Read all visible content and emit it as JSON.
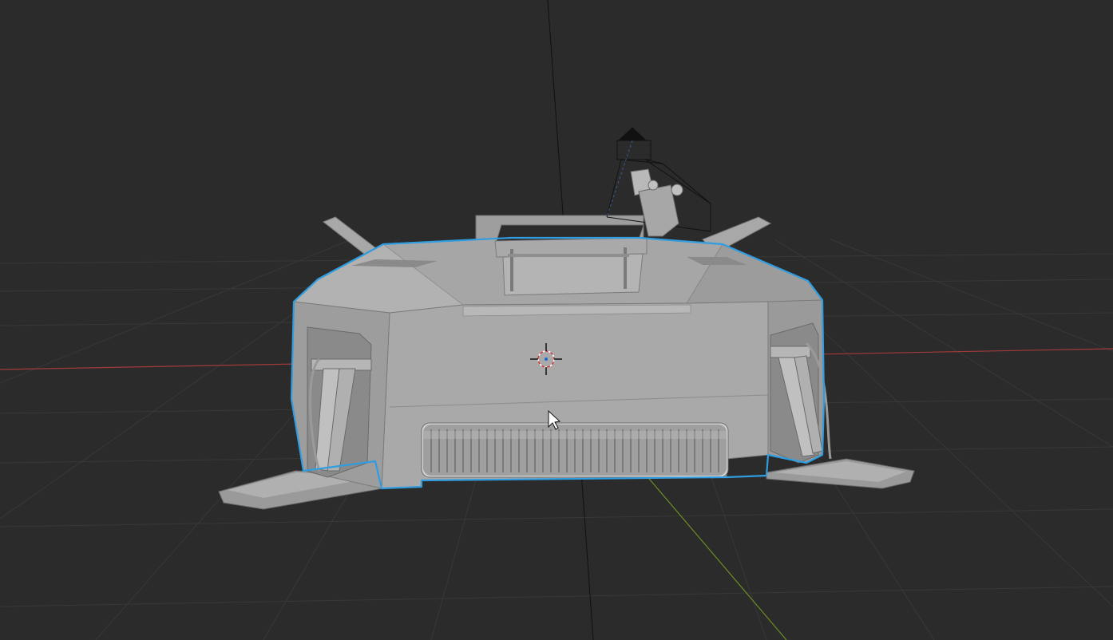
{
  "viewport": {
    "type": "3d-viewport",
    "shading": "solid",
    "selected_object_outline_color": "#2f9de0",
    "background_color": "#2b2b2b",
    "grid_color": "#383838",
    "x_axis_color": "#a33a3a",
    "y_axis_color": "#6b8e23",
    "model_color": "#a3a3a3"
  },
  "icons": {
    "cursor": "3d-cursor-icon",
    "pointer": "mouse-pointer-icon",
    "camera": "camera-icon"
  }
}
